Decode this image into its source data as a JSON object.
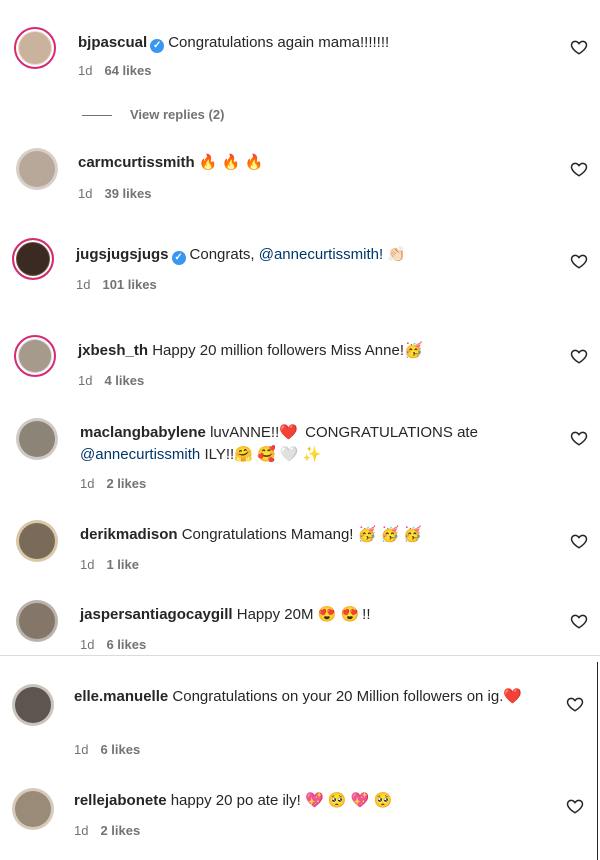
{
  "comments": [
    {
      "user": "bjpascual",
      "verified": true,
      "text": "Congratulations again mama!!!!!!!",
      "time": "1d",
      "likes": "64 likes",
      "emoji": "",
      "mention": "",
      "text2": ""
    },
    {
      "user": "carmcurtissmith",
      "verified": false,
      "text": "",
      "time": "1d",
      "likes": "39 likes",
      "emoji": "🔥 🔥 🔥",
      "mention": "",
      "text2": ""
    },
    {
      "user": "jugsjugsjugs",
      "verified": true,
      "text": "Congrats, ",
      "time": "1d",
      "likes": "101 likes",
      "emoji": "👏🏻",
      "mention": "@annecurtissmith!",
      "text2": ""
    },
    {
      "user": "jxbesh_th",
      "verified": false,
      "text": "Happy 20 million followers Miss Anne!",
      "time": "1d",
      "likes": "4 likes",
      "emoji": "🥳",
      "mention": "",
      "text2": ""
    },
    {
      "user": "maclangbabylene",
      "verified": false,
      "text": "luvANNE!!",
      "time": "1d",
      "likes": "2 likes",
      "emoji": "❤️",
      "mention": "@annecurtissmith",
      "text2": "CONGRATULATIONS ate",
      "text3": "ILY!!",
      "emoji2": "🤗 🥰 🤍 ✨"
    },
    {
      "user": "derikmadison",
      "verified": false,
      "text": "Congratulations Mamang!",
      "time": "1d",
      "likes": "1 like",
      "emoji": "🥳 🥳 🥳",
      "mention": "",
      "text2": ""
    },
    {
      "user": "jaspersantiagocaygill",
      "verified": false,
      "text": "Happy 20M",
      "time": "1d",
      "likes": "6 likes",
      "emoji": "😍 😍",
      "mention": "",
      "text2": "!!"
    },
    {
      "user": "elle.manuelle",
      "verified": false,
      "text": "Congratulations on your 20 Million followers on ig.",
      "time": "1d",
      "likes": "6 likes",
      "emoji": "❤️",
      "mention": "",
      "text2": ""
    },
    {
      "user": "rellejabonete",
      "verified": false,
      "text": "happy 20 po ate ily!",
      "time": "1d",
      "likes": "2 likes",
      "emoji": "💖 🥺 💖 🥺",
      "mention": "",
      "text2": ""
    }
  ],
  "view_replies": "View replies (2)",
  "icons": {
    "like": "heart-outline-icon",
    "verified": "verified-badge-icon"
  },
  "colors": {
    "ring": "#d62976",
    "verified": "#3897f0",
    "mention": "#00376b",
    "meta": "#737373"
  }
}
